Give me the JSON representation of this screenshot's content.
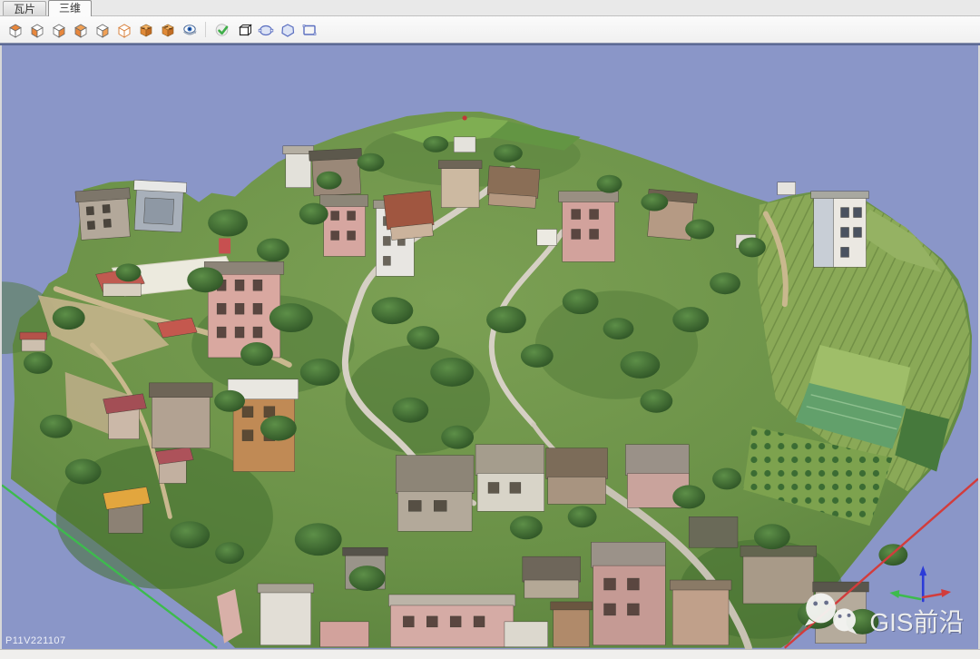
{
  "tabs": [
    {
      "label": "瓦片",
      "active": false
    },
    {
      "label": "三维",
      "active": true
    }
  ],
  "toolbar": {
    "icons": [
      {
        "name": "view-top-icon"
      },
      {
        "name": "view-front-icon"
      },
      {
        "name": "view-left-icon"
      },
      {
        "name": "view-iso-icon"
      },
      {
        "name": "view-right-icon"
      },
      {
        "name": "view-bottom-icon"
      },
      {
        "name": "box-front-icon"
      },
      {
        "name": "box-back-icon"
      },
      {
        "name": "rotate-view-eye-icon"
      },
      {
        "name": "confirm-selection-icon"
      },
      {
        "name": "box-select-3d-icon"
      },
      {
        "name": "circle-select-icon"
      },
      {
        "name": "polygon-select-icon"
      },
      {
        "name": "rectangle-select-icon"
      }
    ]
  },
  "viewport": {
    "background_color": "#8a96c8",
    "model_label": "P11V221107",
    "watermark": {
      "text": "GIS前沿",
      "icon": "wechat-icon"
    },
    "axes": {
      "x_color": "#d23c3c",
      "y_color": "#3dbb4d",
      "z_color": "#2b3bd8"
    },
    "scene_description": "Oblique 3D photogrammetry mesh of a hillside village: dense multi-storey houses (white, pink, tan), red and grey roofs, winding roads, trees, crop fields on the right, white concrete court on the left."
  }
}
